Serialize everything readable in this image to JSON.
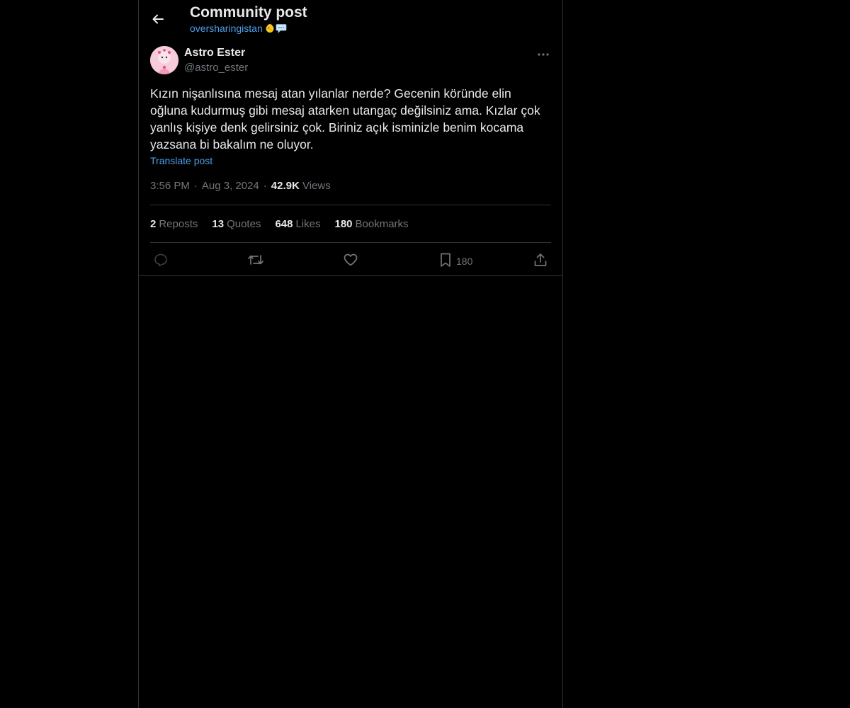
{
  "header": {
    "title": "Community post",
    "community": "oversharingistan"
  },
  "post": {
    "author_name": "Astro Ester",
    "author_handle": "@astro_ester",
    "text": "Kızın nişanlısına mesaj atan yılanlar nerde? Gecenin köründe elin oğluna kudurmuş gibi mesaj atarken utangaç değilsiniz ama. Kızlar çok yanlış kişiye denk gelirsiniz çok. Biriniz açık isminizle benim kocama yazsana bi bakalım ne oluyor.",
    "translate_label": "Translate post",
    "time": "3:56 PM",
    "date": "Aug 3, 2024",
    "views_count": "42.9K",
    "views_label": "Views",
    "separator": "·"
  },
  "stats": {
    "reposts_count": "2",
    "reposts_label": "Reposts",
    "quotes_count": "13",
    "quotes_label": "Quotes",
    "likes_count": "648",
    "likes_label": "Likes",
    "bookmarks_count": "180",
    "bookmarks_label": "Bookmarks"
  },
  "actions": {
    "reply_icon": "reply-icon",
    "repost_icon": "repost-icon",
    "like_icon": "heart-icon",
    "bookmark_icon": "bookmark-icon",
    "bookmark_count": "180",
    "share_icon": "share-icon"
  },
  "colors": {
    "background": "#000000",
    "text": "#e7e9ea",
    "muted": "#71767b",
    "link": "#4c9ee8",
    "border": "#2f3336"
  }
}
